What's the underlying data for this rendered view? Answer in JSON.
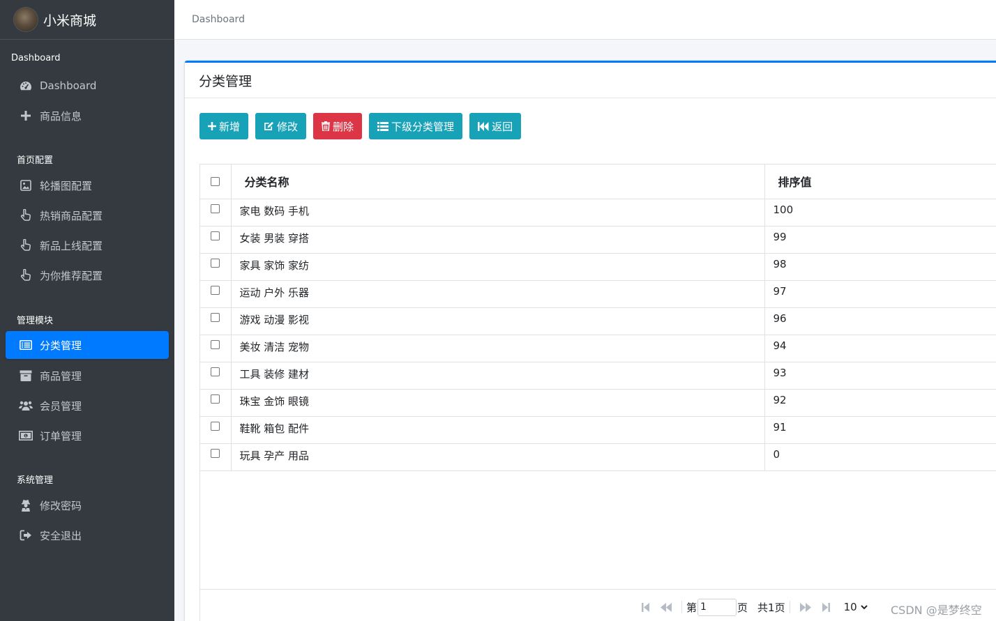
{
  "brand": {
    "name": "小米商城"
  },
  "sidebar": {
    "sections": {
      "dashboard": "Dashboard",
      "home_config": "首页配置",
      "modules": "管理模块",
      "system": "系统管理"
    },
    "items": [
      {
        "label": "Dashboard",
        "icon": "dashboard-gauge-icon"
      },
      {
        "label": "商品信息",
        "icon": "plus-icon"
      },
      {
        "label": "轮播图配置",
        "icon": "image-icon"
      },
      {
        "label": "热销商品配置",
        "icon": "hand-pointer-icon"
      },
      {
        "label": "新品上线配置",
        "icon": "hand-pointer-icon"
      },
      {
        "label": "为你推荐配置",
        "icon": "hand-pointer-icon"
      },
      {
        "label": "分类管理",
        "icon": "list-icon",
        "active": true
      },
      {
        "label": "商品管理",
        "icon": "archive-icon"
      },
      {
        "label": "会员管理",
        "icon": "users-icon"
      },
      {
        "label": "订单管理",
        "icon": "money-bill-icon"
      },
      {
        "label": "修改密码",
        "icon": "user-secret-icon"
      },
      {
        "label": "安全退出",
        "icon": "sign-out-icon"
      }
    ]
  },
  "header": {
    "breadcrumb": "Dashboard"
  },
  "card": {
    "title": "分类管理"
  },
  "toolbar": {
    "add": "新增",
    "edit": "修改",
    "delete": "删除",
    "sub": "下级分类管理",
    "back": "返回"
  },
  "table": {
    "columns": [
      "分类名称",
      "排序值"
    ],
    "rows": [
      {
        "name": "家电 数码 手机",
        "rank": "100"
      },
      {
        "name": "女装 男装 穿搭",
        "rank": "99"
      },
      {
        "name": "家具 家饰 家纺",
        "rank": "98"
      },
      {
        "name": "运动 户外 乐器",
        "rank": "97"
      },
      {
        "name": "游戏 动漫 影视",
        "rank": "96"
      },
      {
        "name": "美妆 清洁 宠物",
        "rank": "94"
      },
      {
        "name": "工具 装修 建材",
        "rank": "93"
      },
      {
        "name": "珠宝 金饰 眼镜",
        "rank": "92"
      },
      {
        "name": "鞋靴 箱包 配件",
        "rank": "91"
      },
      {
        "name": "玩具 孕产 用品",
        "rank": "0"
      }
    ]
  },
  "pager": {
    "page_prefix": "第",
    "page_value": "1",
    "page_suffix": "页",
    "total": "共1页",
    "page_size": "10"
  },
  "watermark": "CSDN @是梦终空",
  "colors": {
    "sidebar": "#343a40",
    "active": "#007bff",
    "info": "#17a2b8",
    "danger": "#dc3545"
  }
}
